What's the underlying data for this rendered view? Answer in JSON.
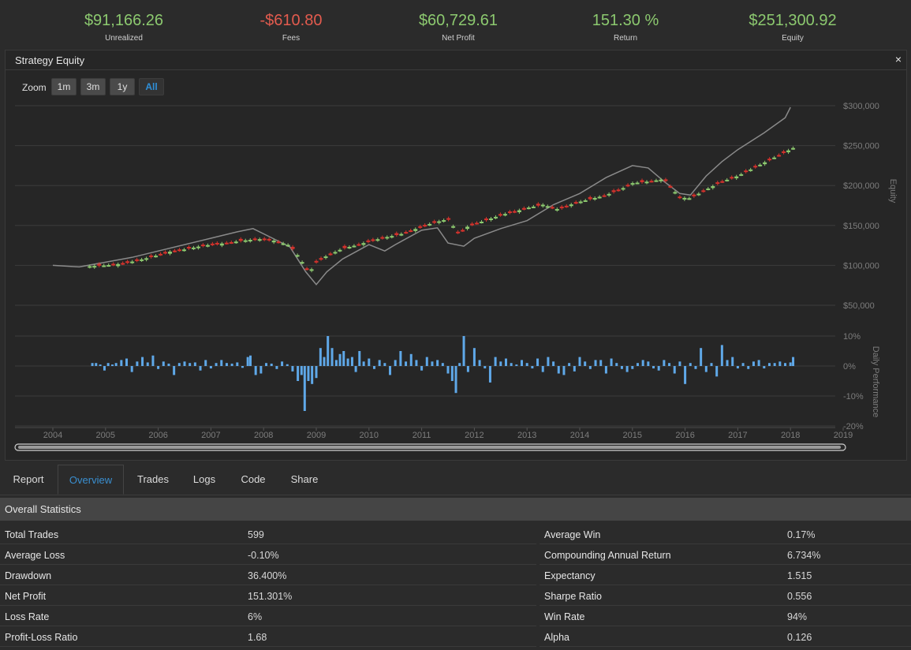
{
  "kpis": [
    {
      "value": "$91,166.26",
      "label": "Unrealized",
      "tone": "pos"
    },
    {
      "value": "-$610.80",
      "label": "Fees",
      "tone": "neg"
    },
    {
      "value": "$60,729.61",
      "label": "Net Profit",
      "tone": "pos"
    },
    {
      "value": "151.30 %",
      "label": "Return",
      "tone": "pos"
    },
    {
      "value": "$251,300.92",
      "label": "Equity",
      "tone": "pos"
    }
  ],
  "panel": {
    "title": "Strategy Equity",
    "close_icon": "×"
  },
  "zoom": {
    "label": "Zoom",
    "buttons": [
      "1m",
      "3m",
      "1y",
      "All"
    ],
    "active": "All"
  },
  "colors": {
    "up": "#8cc96f",
    "down": "#d4322c",
    "benchmark": "#8a8a8a",
    "bars": "#5fa8e8",
    "accent": "#3a8fd0"
  },
  "chart_data": [
    {
      "type": "line",
      "title": "",
      "ylabel": "Equity",
      "y_ticks": [
        "$50,000",
        "$100,000",
        "$150,000",
        "$200,000",
        "$250,000",
        "$300,000"
      ],
      "ylim": [
        0,
        300000
      ],
      "x_ticks": [
        "2004",
        "2005",
        "2006",
        "2007",
        "2008",
        "2009",
        "2010",
        "2011",
        "2012",
        "2013",
        "2014",
        "2015",
        "2016",
        "2017",
        "2018",
        "2019"
      ],
      "xlim": [
        2004,
        2019
      ],
      "series": [
        {
          "style": "candlestick",
          "x": [
            2004.7,
            2005.0,
            2005.3,
            2005.6,
            2005.9,
            2006.2,
            2006.5,
            2006.8,
            2007.0,
            2007.3,
            2007.6,
            2007.9,
            2008.2,
            2008.5,
            2008.7,
            2008.8,
            2008.9,
            2009.0,
            2009.2,
            2009.5,
            2009.8,
            2010.0,
            2010.3,
            2010.6,
            2010.9,
            2011.2,
            2011.5,
            2011.7,
            2011.9,
            2012.2,
            2012.5,
            2012.8,
            2013.0,
            2013.3,
            2013.6,
            2013.9,
            2014.2,
            2014.5,
            2014.8,
            2015.0,
            2015.3,
            2015.6,
            2015.9,
            2016.1,
            2016.4,
            2016.7,
            2017.0,
            2017.3,
            2017.6,
            2017.9,
            2018.05
          ],
          "close": [
            99000,
            100000,
            102000,
            106000,
            111000,
            117000,
            120000,
            124000,
            126000,
            128000,
            131000,
            133000,
            131000,
            125000,
            108000,
            96000,
            94000,
            104000,
            112000,
            121000,
            126000,
            130000,
            135000,
            139000,
            146000,
            153000,
            158000,
            140000,
            150000,
            156000,
            163000,
            168000,
            172000,
            176000,
            170000,
            178000,
            183000,
            188000,
            196000,
            203000,
            205000,
            208000,
            185000,
            184000,
            195000,
            205000,
            212000,
            222000,
            232000,
            242000,
            247000
          ]
        },
        {
          "style": "line",
          "x": [
            2004.0,
            2004.5,
            2005.0,
            2005.5,
            2006.0,
            2006.5,
            2007.0,
            2007.5,
            2007.8,
            2008.2,
            2008.5,
            2008.8,
            2009.0,
            2009.2,
            2009.5,
            2010.0,
            2010.3,
            2010.5,
            2011.0,
            2011.3,
            2011.5,
            2011.8,
            2012.0,
            2012.5,
            2013.0,
            2013.5,
            2014.0,
            2014.5,
            2015.0,
            2015.3,
            2015.6,
            2015.9,
            2016.1,
            2016.4,
            2016.7,
            2017.0,
            2017.5,
            2017.9,
            2018.0
          ],
          "y": [
            100000,
            98000,
            104000,
            110000,
            118000,
            126000,
            134000,
            142000,
            146000,
            133000,
            123000,
            92000,
            76000,
            92000,
            108000,
            126000,
            118000,
            126000,
            144000,
            147000,
            128000,
            124000,
            134000,
            146000,
            156000,
            176000,
            190000,
            210000,
            225000,
            222000,
            205000,
            190000,
            188000,
            212000,
            230000,
            245000,
            266000,
            285000,
            298000
          ]
        }
      ]
    },
    {
      "type": "bar",
      "title": "",
      "ylabel": "Daily Performance",
      "y_ticks": [
        "10%",
        "0%",
        "-10%",
        "-20%"
      ],
      "ylim": [
        -20,
        10
      ],
      "x": [
        2004.75,
        2004.82,
        2004.9,
        2004.98,
        2005.05,
        2005.13,
        2005.2,
        2005.3,
        2005.4,
        2005.5,
        2005.6,
        2005.7,
        2005.8,
        2005.9,
        2006.0,
        2006.1,
        2006.2,
        2006.3,
        2006.4,
        2006.5,
        2006.6,
        2006.7,
        2006.8,
        2006.9,
        2007.0,
        2007.1,
        2007.2,
        2007.3,
        2007.4,
        2007.5,
        2007.6,
        2007.7,
        2007.75,
        2007.85,
        2007.95,
        2008.05,
        2008.15,
        2008.25,
        2008.35,
        2008.45,
        2008.55,
        2008.65,
        2008.72,
        2008.78,
        2008.85,
        2008.92,
        2009.0,
        2009.08,
        2009.15,
        2009.22,
        2009.3,
        2009.38,
        2009.45,
        2009.52,
        2009.6,
        2009.68,
        2009.75,
        2009.82,
        2009.9,
        2010.0,
        2010.1,
        2010.2,
        2010.3,
        2010.4,
        2010.5,
        2010.6,
        2010.7,
        2010.8,
        2010.9,
        2011.0,
        2011.1,
        2011.2,
        2011.3,
        2011.4,
        2011.5,
        2011.58,
        2011.65,
        2011.72,
        2011.8,
        2011.88,
        2012.0,
        2012.1,
        2012.2,
        2012.3,
        2012.4,
        2012.5,
        2012.6,
        2012.7,
        2012.8,
        2012.9,
        2013.0,
        2013.1,
        2013.2,
        2013.3,
        2013.4,
        2013.5,
        2013.6,
        2013.7,
        2013.8,
        2013.9,
        2014.0,
        2014.1,
        2014.2,
        2014.3,
        2014.4,
        2014.5,
        2014.6,
        2014.7,
        2014.8,
        2014.9,
        2015.0,
        2015.1,
        2015.2,
        2015.3,
        2015.4,
        2015.5,
        2015.6,
        2015.7,
        2015.8,
        2015.9,
        2016.0,
        2016.1,
        2016.2,
        2016.3,
        2016.4,
        2016.5,
        2016.6,
        2016.7,
        2016.8,
        2016.9,
        2017.0,
        2017.1,
        2017.2,
        2017.3,
        2017.4,
        2017.5,
        2017.6,
        2017.7,
        2017.8,
        2017.9,
        2018.0,
        2018.05
      ],
      "values": [
        1,
        1,
        0.5,
        -1.5,
        1,
        0.5,
        1,
        2,
        2.5,
        -2,
        1.5,
        3,
        1.2,
        3.5,
        -1,
        1.5,
        0.8,
        -3,
        1,
        1.5,
        1,
        1.2,
        -1.5,
        2,
        -0.8,
        1,
        2,
        1,
        0.8,
        1.2,
        -0.6,
        3,
        3.5,
        -3,
        -2.5,
        1,
        0.8,
        -1,
        1.5,
        0.6,
        -1.8,
        -5,
        -3,
        -15,
        -5,
        -6,
        -4,
        6,
        3,
        10,
        6,
        2,
        4,
        5,
        2.5,
        3,
        -2,
        5,
        1.5,
        2.5,
        -1,
        2,
        1,
        -3,
        2,
        5,
        1.5,
        4,
        2,
        -1.5,
        3,
        1.5,
        2,
        1,
        -2.5,
        -5,
        -9,
        1,
        10,
        -2,
        6,
        2,
        -0.8,
        -5.5,
        3,
        1.5,
        2.5,
        1,
        0.5,
        2,
        1,
        -0.8,
        2.5,
        -2,
        3,
        1.5,
        -2.5,
        -3,
        1,
        -1.8,
        3,
        1.5,
        -1,
        2,
        2,
        -2.5,
        2.5,
        1,
        -1,
        -2,
        -1,
        1,
        2,
        1.5,
        -0.8,
        -1.5,
        2,
        1,
        -2.5,
        1.5,
        -6,
        1,
        -1,
        6,
        -2,
        1,
        -3.5,
        7,
        2,
        3,
        -0.8,
        1,
        -1,
        1.5,
        2,
        -0.8,
        1,
        1,
        1.5,
        1,
        1.2,
        3,
        -3
      ]
    }
  ],
  "tabs": {
    "items": [
      "Report",
      "Overview",
      "Trades",
      "Logs",
      "Code",
      "Share"
    ],
    "active": "Overview"
  },
  "stats": {
    "title": "Overall Statistics",
    "rows": [
      {
        "k1": "Total Trades",
        "v1": "599",
        "k2": "Average Win",
        "v2": "0.17%"
      },
      {
        "k1": "Average Loss",
        "v1": "-0.10%",
        "k2": "Compounding Annual Return",
        "v2": "6.734%"
      },
      {
        "k1": "Drawdown",
        "v1": "36.400%",
        "k2": "Expectancy",
        "v2": "1.515"
      },
      {
        "k1": "Net Profit",
        "v1": "151.301%",
        "k2": "Sharpe Ratio",
        "v2": "0.556"
      },
      {
        "k1": "Loss Rate",
        "v1": "6%",
        "k2": "Win Rate",
        "v2": "94%"
      },
      {
        "k1": "Profit-Loss Ratio",
        "v1": "1.68",
        "k2": "Alpha",
        "v2": "0.126"
      }
    ]
  }
}
